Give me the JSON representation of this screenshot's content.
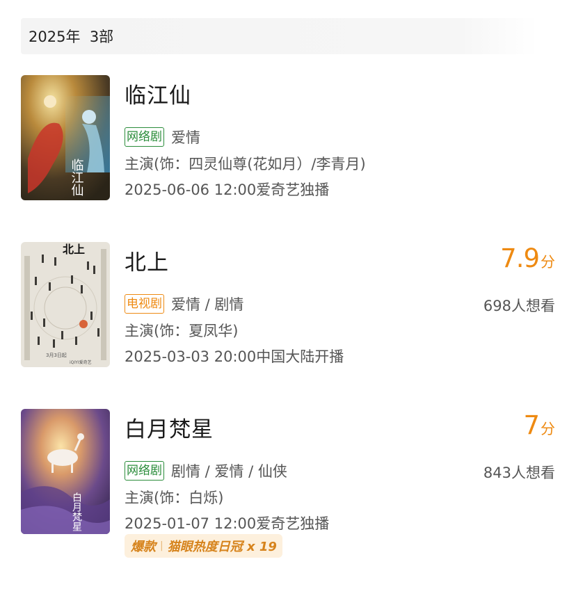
{
  "header": {
    "year": "2025年",
    "count": "3部"
  },
  "items": [
    {
      "title": "临江仙",
      "tag": "网络剧",
      "genres": "爱情",
      "cast": "主演(饰：四灵仙尊(花如月）/李青月)",
      "release": "2025-06-06 12:00爱奇艺独播",
      "poster_text": "临江仙",
      "colors": {
        "tag": "#2a8c3a"
      }
    },
    {
      "title": "北上",
      "score": "7.9",
      "score_unit": "分",
      "tag": "电视剧",
      "genres": "爱情 / 剧情",
      "wants": "698人想看",
      "cast": "主演(饰：夏凤华)",
      "release": "2025-03-03 20:00中国大陆开播",
      "poster_text": "北上",
      "poster_date": "3月3日起",
      "poster_brand": "iQIYI爱奇艺",
      "colors": {
        "tag": "#ee8a12",
        "score": "#ee8a12"
      }
    },
    {
      "title": "白月梵星",
      "score": "7",
      "score_unit": "分",
      "tag": "网络剧",
      "genres": "剧情 / 爱情 / 仙侠",
      "wants": "843人想看",
      "cast": "主演(饰：白烁)",
      "release": "2025-01-07 12:00爱奇艺独播",
      "poster_text": "白月梵星",
      "badge": {
        "label": "爆款",
        "text": "猫眼热度日冠 x 19"
      },
      "colors": {
        "tag": "#2a8c3a",
        "score": "#ee8a12"
      }
    }
  ]
}
